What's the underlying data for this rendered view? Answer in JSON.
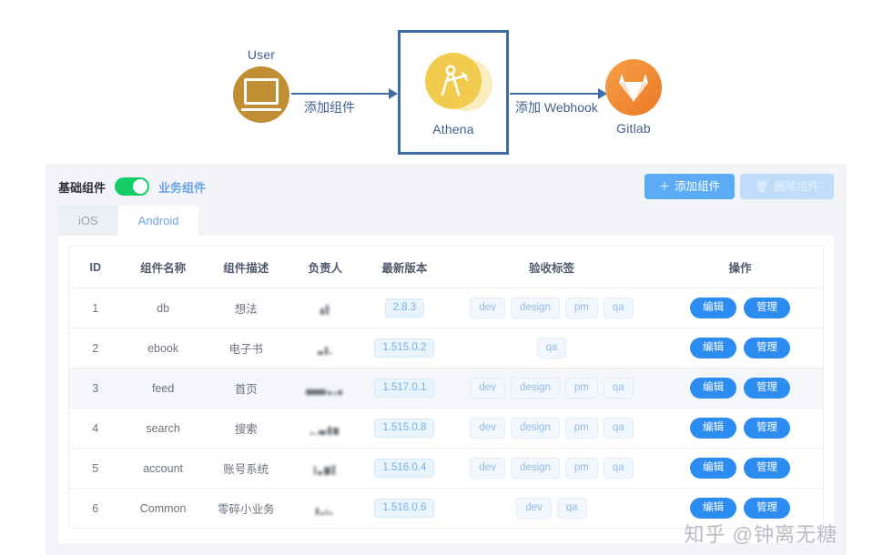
{
  "diagram": {
    "nodes": [
      {
        "id": "user",
        "label": "User",
        "icon": "monitor-icon"
      },
      {
        "id": "athena",
        "label": "Athena",
        "icon": "compass-icon"
      },
      {
        "id": "gitlab",
        "label": "Gitlab",
        "icon": "gitlab-fox-icon"
      }
    ],
    "arrows": [
      {
        "id": "arrow1",
        "label": "添加组件"
      },
      {
        "id": "arrow2",
        "label": "添加 Webhook"
      }
    ],
    "colors": {
      "user_circle": "#c08f33",
      "athena_circle": "#f0cb4e",
      "gitlab_circle": "#ec7824",
      "arrow": "#3e6da5",
      "box_border": "#3e6da5",
      "label_text": "#3f5f8f"
    }
  },
  "toolbar": {
    "left_label": "基础组件",
    "right_label": "业务组件",
    "switch_on": true,
    "switch_color": "#13ce66",
    "add_button": "添加组件",
    "add_button_icon": "plus-icon",
    "delete_button": "删除组件",
    "delete_button_icon": "trash-icon",
    "primary_color": "#5babf5"
  },
  "tabs": [
    {
      "label": "iOS",
      "active": false
    },
    {
      "label": "Android",
      "active": true
    }
  ],
  "table": {
    "headers": [
      "ID",
      "组件名称",
      "组件描述",
      "负责人",
      "最新版本",
      "验收标签",
      "操作"
    ],
    "ops": {
      "edit": "编辑",
      "manage": "管理"
    },
    "rows": [
      {
        "id": "1",
        "name": "db",
        "desc": "想法",
        "owner_redacted": true,
        "version": "2.8.3",
        "tags": [
          "dev",
          "design",
          "pm",
          "qa"
        ],
        "hover": false
      },
      {
        "id": "2",
        "name": "ebook",
        "desc": "电子书",
        "owner_redacted": true,
        "version": "1.515.0.2",
        "tags": [
          "qa"
        ],
        "hover": false
      },
      {
        "id": "3",
        "name": "feed",
        "desc": "首页",
        "owner_redacted": true,
        "version": "1.517.0.1",
        "tags": [
          "dev",
          "design",
          "pm",
          "qa"
        ],
        "hover": true
      },
      {
        "id": "4",
        "name": "search",
        "desc": "搜索",
        "owner_redacted": true,
        "version": "1.515.0.8",
        "tags": [
          "dev",
          "design",
          "pm",
          "qa"
        ],
        "hover": false
      },
      {
        "id": "5",
        "name": "account",
        "desc": "账号系统",
        "owner_redacted": true,
        "version": "1.516.0.4",
        "tags": [
          "dev",
          "design",
          "pm",
          "qa"
        ],
        "hover": false
      },
      {
        "id": "6",
        "name": "Common",
        "desc": "零碎小业务",
        "owner_redacted": true,
        "version": "1.516.0.6",
        "tags": [
          "dev",
          "qa"
        ],
        "hover": false
      }
    ]
  },
  "watermark": {
    "text": "知乎 @钟离无糖"
  }
}
